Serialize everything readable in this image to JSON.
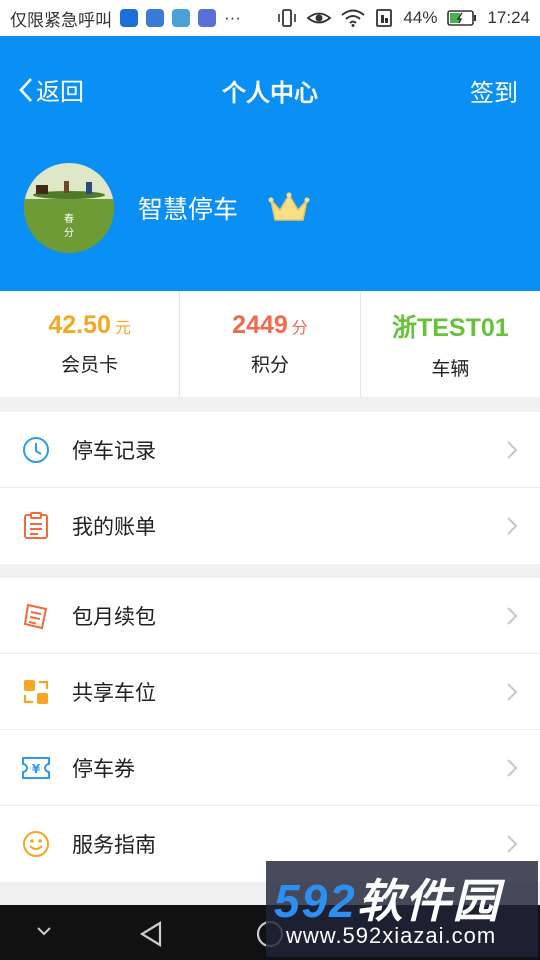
{
  "status_bar": {
    "notification_text": "仅限紧急呼叫",
    "ellipsis": "···",
    "battery": "44%",
    "time": "17:24"
  },
  "nav": {
    "back_label": "返回",
    "title": "个人中心",
    "signin_label": "签到"
  },
  "profile": {
    "avatar_caption": "春\n分",
    "name": "智慧停车"
  },
  "stats": [
    {
      "value": "42.50",
      "unit": "元",
      "label": "会员卡",
      "color": "#f5a623"
    },
    {
      "value": "2449",
      "unit": "分",
      "label": "积分",
      "color": "#f2684a"
    },
    {
      "value": "浙TEST01",
      "unit": "",
      "label": "车辆",
      "color": "#67c23a"
    }
  ],
  "menu_group_1": [
    {
      "label": "停车记录",
      "icon": "clock-icon"
    },
    {
      "label": "我的账单",
      "icon": "bill-icon"
    }
  ],
  "menu_group_2": [
    {
      "label": "包月续包",
      "icon": "receipt-icon"
    },
    {
      "label": "共享车位",
      "icon": "share-icon"
    },
    {
      "label": "停车券",
      "icon": "coupon-icon"
    },
    {
      "label": "服务指南",
      "icon": "smiley-icon"
    }
  ],
  "colors": {
    "header": "#0a90f5",
    "icon_blue": "#2d9bf0",
    "icon_orange": "#f26b3a",
    "icon_yellow": "#f5a623"
  },
  "watermark": {
    "brand_num": "592",
    "brand_text": "软件园",
    "url": "www.592xiazai.com"
  }
}
